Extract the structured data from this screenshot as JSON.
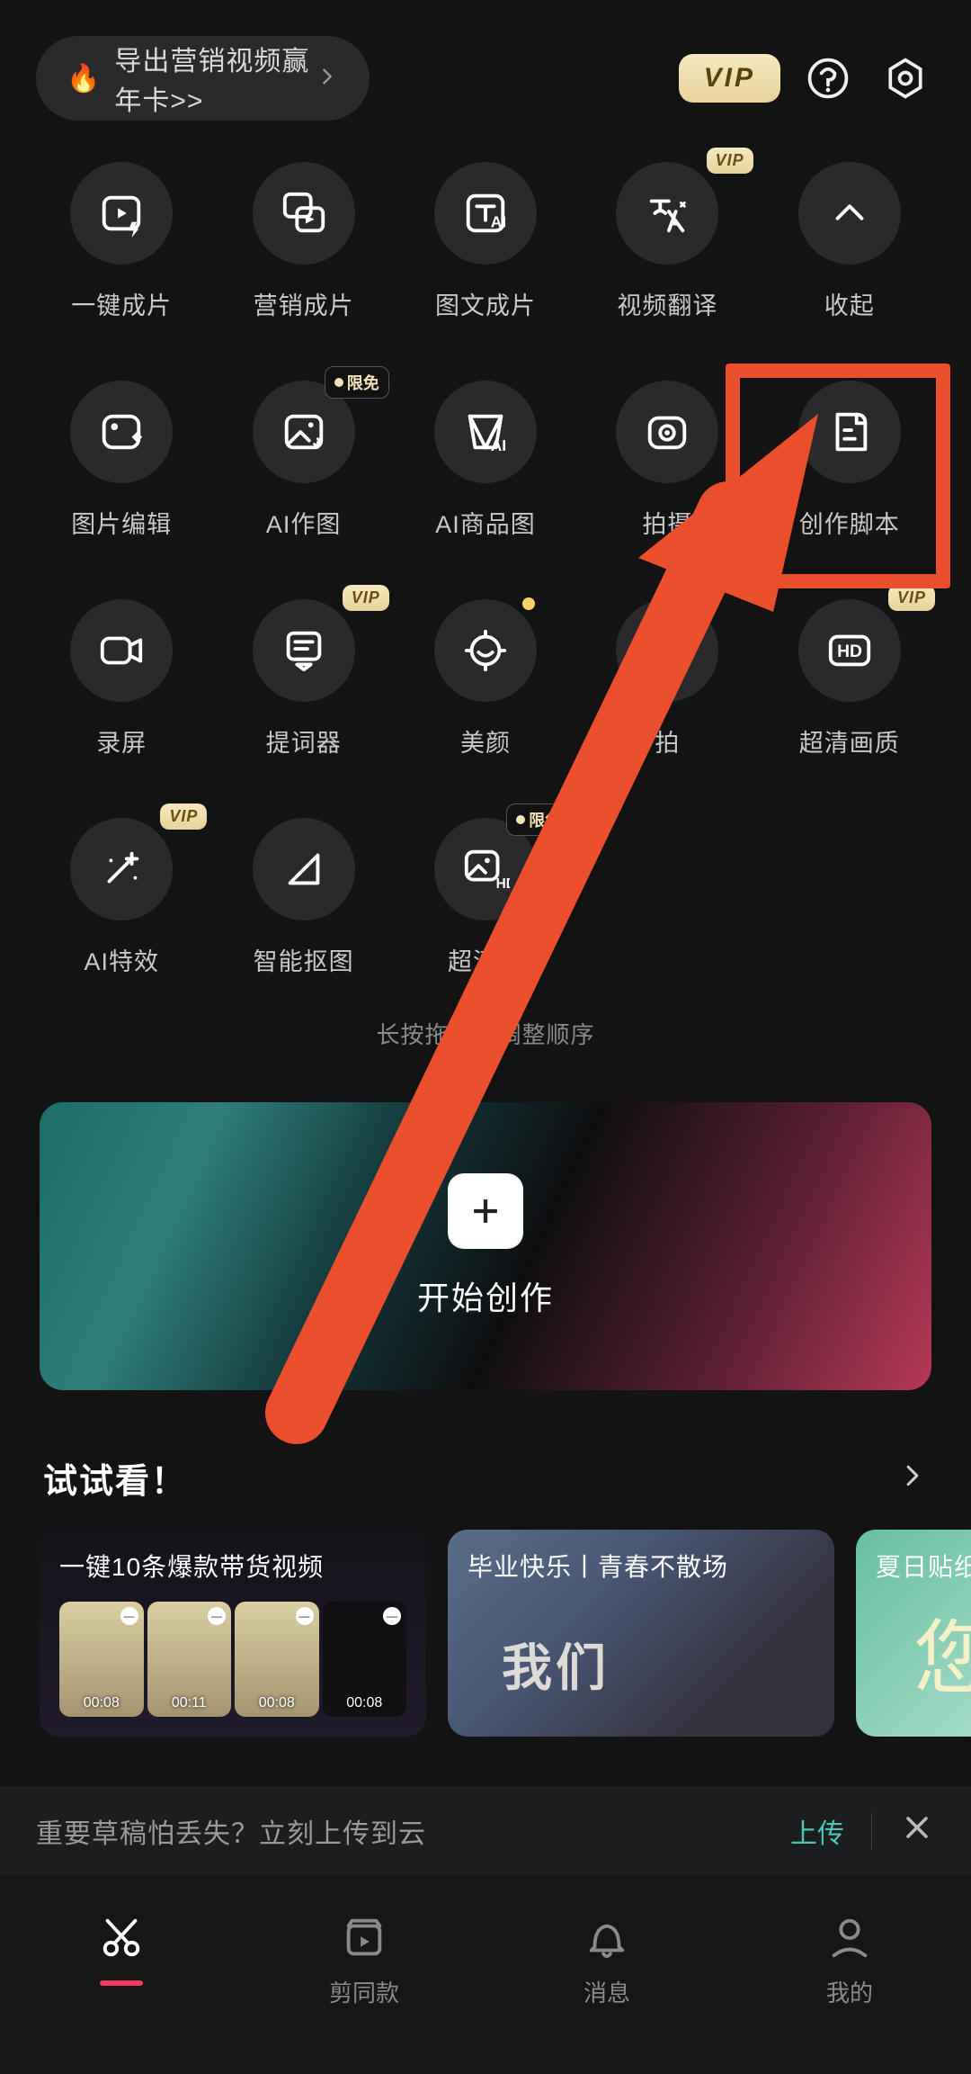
{
  "top": {
    "promo": "导出营销视频赢年卡>>",
    "vip": "VIP"
  },
  "tools": [
    {
      "label": "一键成片",
      "icon": "play-lightning",
      "tag": null
    },
    {
      "label": "营销成片",
      "icon": "copy-play",
      "tag": null
    },
    {
      "label": "图文成片",
      "icon": "text-ai",
      "tag": null
    },
    {
      "label": "视频翻译",
      "icon": "translate",
      "tag": "vip"
    },
    {
      "label": "收起",
      "icon": "chevron-up",
      "tag": null
    },
    {
      "label": "图片编辑",
      "icon": "image-edit",
      "tag": null
    },
    {
      "label": "AI作图",
      "icon": "image-spark",
      "tag": "free"
    },
    {
      "label": "AI商品图",
      "icon": "shop-ai",
      "tag": null
    },
    {
      "label": "拍摄",
      "icon": "camera",
      "tag": null
    },
    {
      "label": "创作脚本",
      "icon": "script",
      "tag": null
    },
    {
      "label": "录屏",
      "icon": "record",
      "tag": null
    },
    {
      "label": "提词器",
      "icon": "teleprompter",
      "tag": "vip"
    },
    {
      "label": "美颜",
      "icon": "beauty",
      "tag": null,
      "dot": true
    },
    {
      "label": "拍",
      "icon": "face",
      "tag": null
    },
    {
      "label": "超清画质",
      "icon": "hd",
      "tag": "vip"
    },
    {
      "label": "AI特效",
      "icon": "wand",
      "tag": "vip"
    },
    {
      "label": "智能抠图",
      "icon": "cutout",
      "tag": null
    },
    {
      "label": "超清图",
      "icon": "image-hd",
      "tag": "free"
    }
  ],
  "drag_hint": "长按拖动可调整顺序",
  "start_label": "开始创作",
  "try": {
    "title": "试试看！",
    "cards": [
      {
        "title": "一键10条爆款带货视频",
        "stamps": [
          "00:08",
          "00:11",
          "00:08",
          "00:08"
        ]
      },
      {
        "title": "毕业快乐丨青春不散场"
      },
      {
        "title": "夏日贴纸"
      }
    ]
  },
  "banner": {
    "text": "重要草稿怕丢失？立刻上传到云",
    "action": "上传"
  },
  "nav": [
    {
      "label": "",
      "icon": "cut",
      "active": true
    },
    {
      "label": "剪同款",
      "icon": "template"
    },
    {
      "label": "消息",
      "icon": "bell"
    },
    {
      "label": "我的",
      "icon": "profile"
    }
  ]
}
